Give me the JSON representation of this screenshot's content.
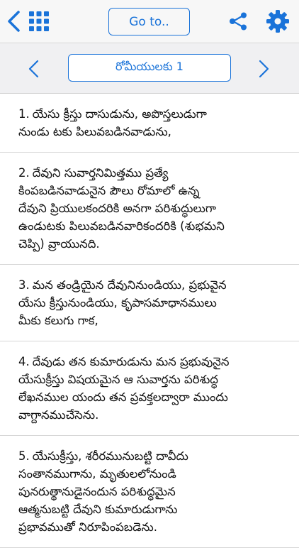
{
  "toolbar": {
    "back_icon": "chevron-left-icon",
    "grid_icon": "grid-icon",
    "goto_label": "Go to..",
    "share_icon": "share-icon",
    "settings_icon": "gear-icon",
    "accent_color": "#1a73d9"
  },
  "chapter_nav": {
    "prev_icon": "chevron-left-icon",
    "next_icon": "chevron-right-icon",
    "chapter_label": "రోమీయులకు 1"
  },
  "verses": [
    {
      "number": "1.",
      "lines": [
        "యేసు క్రీస్తు దాసుడును, అపొస్తలుడుగా",
        "నుండు టకు పిలువబడినవాడును,"
      ]
    },
    {
      "number": "2.",
      "lines": [
        "దేవుని సువార్తనిమిత్తము ప్రత్యే",
        "కింపబడినవాడునైన పౌలు రోమాలో ఉన్న",
        "దేవుని ప్రియులకందరికి అనగా పరిశుద్ధులుగా",
        "ఉండుటకు పిలువబడినవారికందరికి (శుభమని",
        "చెప్పి) వ్రాయునది."
      ]
    },
    {
      "number": "3.",
      "lines": [
        "మన తండ్రియైన దేవునినుండియు, ప్రభువైన",
        "యేసు క్రీస్తునుండియు, కృపాసమాధానములు",
        "మీకు కలుగు గాక,"
      ]
    },
    {
      "number": "4.",
      "lines": [
        "దేవుడు తన కుమారుడును మన ప్రభువునైన",
        "యేసుక్రీస్తు విషయమైన ఆ సువార్తను పరిశుద్ధ",
        "లేఖనముల యందు తన ప్రవక్తలద్వారా ముందు",
        "వాగ్దానముచేసెను."
      ]
    },
    {
      "number": "5.",
      "lines": [
        "యేసుక్రీస్తు, శరీరమునుబట్టి దావీదు",
        "సంతానముగాను, మృతులలోనుండి",
        "పునరుత్థానుడైనందున పరిశుద్ధమైన",
        "ఆత్మనుబట్టి దేవుని కుమారుడుగాను",
        "ప్రభావముతో నిరూపింపబడెను."
      ]
    }
  ]
}
